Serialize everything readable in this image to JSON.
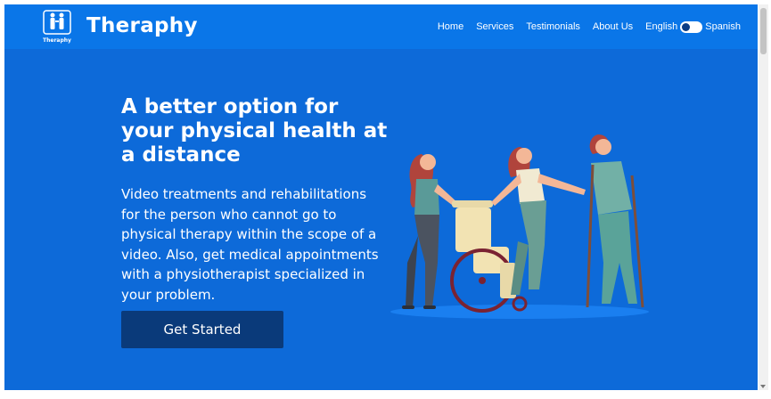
{
  "header": {
    "logo_text": "Theraphy",
    "brand": "Theraphy",
    "nav": {
      "home": "Home",
      "services": "Services",
      "testimonials": "Testimonials",
      "about": "About Us"
    },
    "language": {
      "left": "English",
      "right": "Spanish",
      "selected": "English"
    }
  },
  "hero": {
    "title": "A better option for your physical health at a distance",
    "description": "Video treatments and rehabilitations for the person who cannot go to physical therapy within the scope of a video. Also, get medical appointments with a physiotherapist specialized in your problem.",
    "cta_label": "Get Started"
  },
  "icons": {
    "logo": "therapy-people-logo-icon",
    "illustration": "physiotherapy-illustration"
  },
  "colors": {
    "navbar": "#0a76e8",
    "hero_bg": "#0d6ad9",
    "button": "#0a3a7a"
  }
}
